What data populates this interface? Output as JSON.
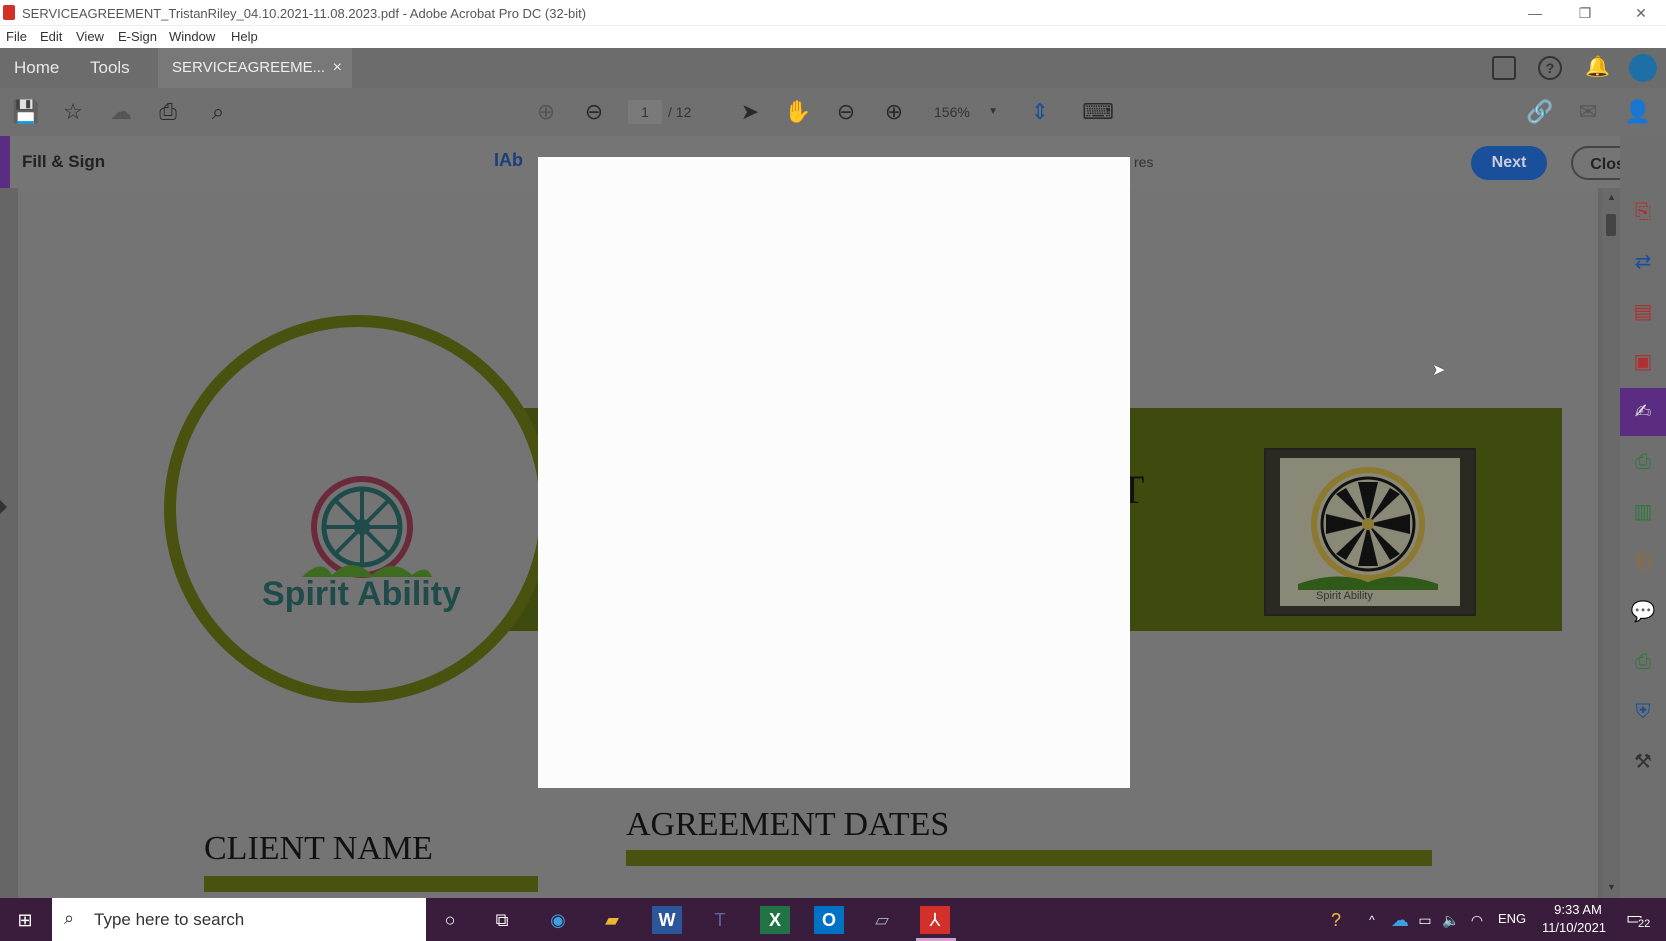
{
  "window": {
    "title": "SERVICEAGREEMENT_TristanRiley_04.10.2021-11.08.2023.pdf - Adobe Acrobat Pro DC (32-bit)",
    "minimize": "—",
    "restore": "❐",
    "close": "✕"
  },
  "menu": [
    "File",
    "Edit",
    "View",
    "E-Sign",
    "Window",
    "Help"
  ],
  "tabs": {
    "home": "Home",
    "tools": "Tools",
    "document": "SERVICEAGREEME...",
    "document_close": "×"
  },
  "toolbar": {
    "page_current": "1",
    "page_total": "/ 12",
    "zoom": "156%"
  },
  "fill_sign": {
    "title": "Fill & Sign",
    "text_tool": "IAb",
    "partial_label": "res",
    "next_label": "Next",
    "close_label": "Close"
  },
  "document": {
    "logo_text": "Spirit Ability",
    "heading_fragment": "T",
    "client_name_label": "CLIENT NAME",
    "agreement_dates_label": "AGREEMENT DATES",
    "photo_caption": "Spirit Ability",
    "accent_color": "#5a6410"
  },
  "taskbar": {
    "search_placeholder": "Type here to search",
    "language": "ENG",
    "time": "9:33 AM",
    "date": "11/10/2021",
    "notification_count": "22"
  },
  "colors": {
    "acrobat_red": "#d3302a",
    "fill_sign_purple": "#5a2d82",
    "next_button": "#1a4f9c",
    "olive_green": "#5a6410"
  }
}
